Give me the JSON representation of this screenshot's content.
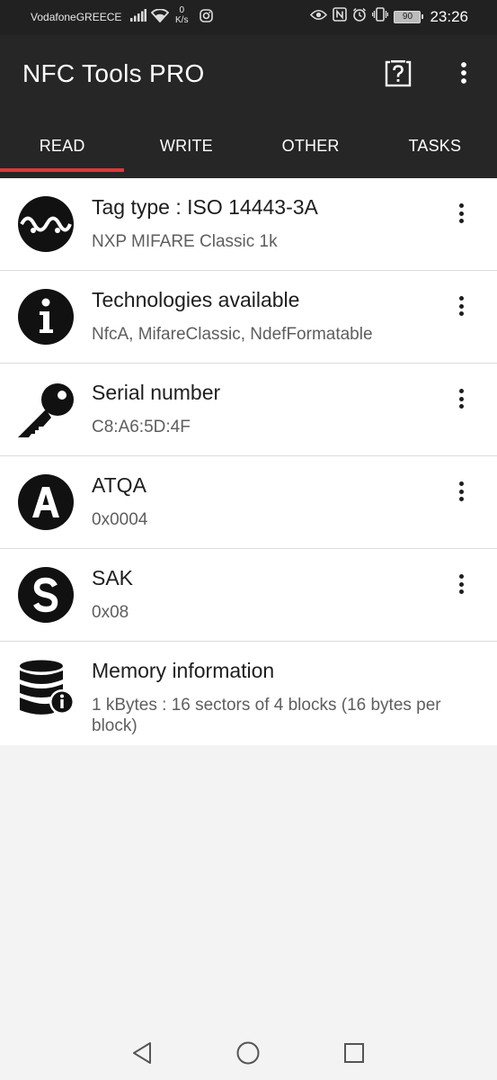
{
  "status_bar": {
    "carrier": "VodafoneGREECE",
    "speed_value": "0",
    "speed_unit": "K/s",
    "battery": "90",
    "time": "23:26"
  },
  "app_bar": {
    "title": "NFC Tools PRO"
  },
  "tabs": [
    {
      "label": "READ",
      "active": true
    },
    {
      "label": "WRITE",
      "active": false
    },
    {
      "label": "OTHER",
      "active": false
    },
    {
      "label": "TASKS",
      "active": false
    }
  ],
  "items": [
    {
      "icon": "waveform-icon",
      "title": "Tag type : ISO 14443-3A",
      "subtitle": "NXP MIFARE Classic 1k"
    },
    {
      "icon": "info-icon",
      "title": "Technologies available",
      "subtitle": "NfcA, MifareClassic, NdefFormatable"
    },
    {
      "icon": "key-icon",
      "title": "Serial number",
      "subtitle": "C8:A6:5D:4F"
    },
    {
      "icon": "letter-a-icon",
      "title": "ATQA",
      "subtitle": "0x0004"
    },
    {
      "icon": "letter-s-icon",
      "title": "SAK",
      "subtitle": "0x08"
    },
    {
      "icon": "database-info-icon",
      "title": "Memory information",
      "subtitle": "1 kBytes : 16 sectors of 4 blocks (16 bytes per block)"
    }
  ],
  "colors": {
    "app_bar": "#262626",
    "tab_indicator": "#d93a3a",
    "background": "#f3f3f3"
  }
}
